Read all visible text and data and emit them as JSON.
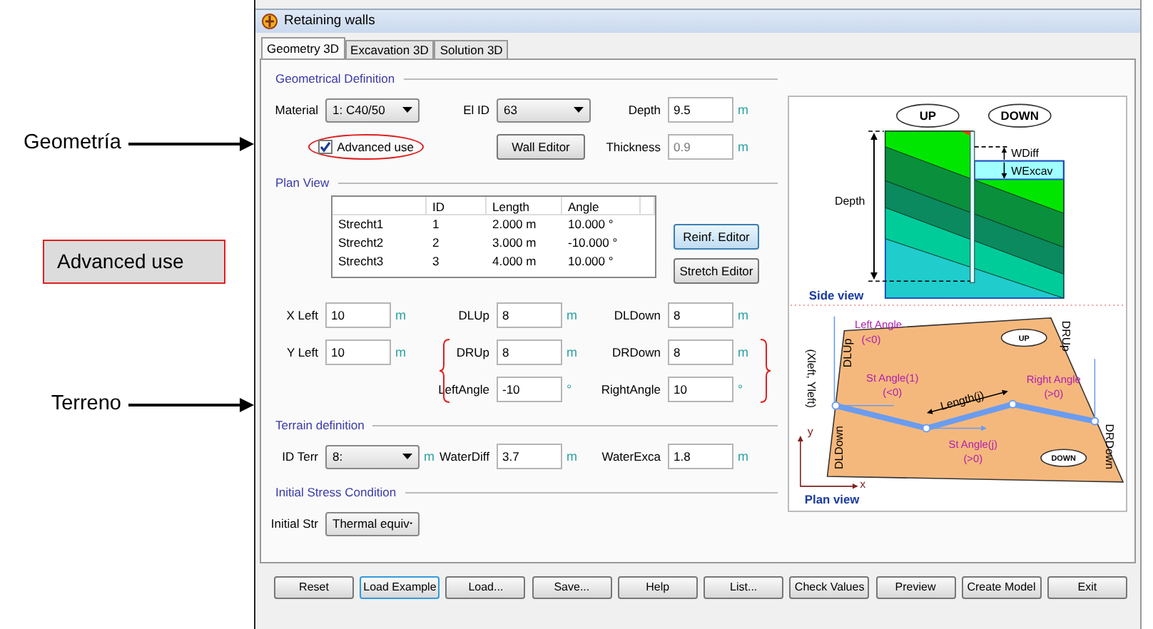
{
  "annotations": [
    {
      "kind": "arrow",
      "text": "Geometría"
    },
    {
      "kind": "box",
      "text": "Advanced use"
    },
    {
      "kind": "arrow",
      "text": "Terreno"
    }
  ],
  "window": {
    "title": "Retaining walls"
  },
  "tabs": [
    {
      "label": "Geometry 3D",
      "selected": true
    },
    {
      "label": "Excavation 3D",
      "selected": false
    },
    {
      "label": "Solution 3D",
      "selected": false
    }
  ],
  "sections": [
    {
      "kind": "form",
      "title": "Geometrical Definition",
      "rows": [
        [
          {
            "kind": "select",
            "label": "Material",
            "value": "1: C40/50"
          },
          {
            "kind": "select",
            "label": "El ID",
            "value": "63"
          },
          {
            "kind": "input",
            "label": "Depth",
            "value": "9.5",
            "unit": "m",
            "disabled": false
          }
        ],
        [
          {
            "kind": "checkbox",
            "label": "Advanced use",
            "checked": true,
            "highlighted": true
          },
          {
            "kind": "button",
            "label": "Wall Editor"
          },
          {
            "kind": "input",
            "label": "Thickness",
            "value": "0.9",
            "unit": "m",
            "disabled": true
          }
        ]
      ]
    },
    {
      "kind": "plan",
      "title": "Plan View",
      "table": {
        "columns": [
          "ID",
          "Length",
          "Angle"
        ],
        "rows": [
          {
            "name": "Strecht1",
            "cells": [
              "1",
              "2.000 m",
              "10.000 °"
            ]
          },
          {
            "name": "Strecht2",
            "cells": [
              "2",
              "3.000 m",
              "-10.000 °"
            ]
          },
          {
            "name": "Strecht3",
            "cells": [
              "3",
              "4.000 m",
              "10.000 °"
            ]
          }
        ]
      },
      "buttons": [
        {
          "label": "Reinf. Editor",
          "highlighted": true
        },
        {
          "label": "Stretch Editor",
          "highlighted": false
        }
      ],
      "rows": [
        [
          {
            "kind": "input",
            "label": "X Left",
            "value": "10",
            "unit": "m",
            "disabled": false
          },
          {
            "kind": "input",
            "label": "DLUp",
            "value": "8",
            "unit": "m",
            "disabled": false
          },
          {
            "kind": "input",
            "label": "DLDown",
            "value": "8",
            "unit": "m",
            "disabled": false
          }
        ],
        [
          {
            "kind": "input",
            "label": "Y Left",
            "value": "10",
            "unit": "m",
            "disabled": false
          },
          {
            "kind": "input",
            "label": "DRUp",
            "value": "8",
            "unit": "m",
            "disabled": false
          },
          {
            "kind": "input",
            "label": "DRDown",
            "value": "8",
            "unit": "m",
            "disabled": false
          }
        ],
        [
          {
            "kind": "none"
          },
          {
            "kind": "input",
            "label": "LeftAngle",
            "value": "-10",
            "unit": "°",
            "disabled": false
          },
          {
            "kind": "input",
            "label": "RightAngle",
            "value": "10",
            "unit": "°",
            "disabled": false
          }
        ]
      ]
    },
    {
      "kind": "form",
      "title": "Terrain definition",
      "rows": [
        [
          {
            "kind": "select",
            "label": "ID Terr",
            "value": "8:",
            "unit": "m"
          },
          {
            "kind": "input",
            "label": "WaterDiff",
            "value": "3.7",
            "unit": "m",
            "disabled": false
          },
          {
            "kind": "input",
            "label": "WaterExca",
            "value": "1.8",
            "unit": "m",
            "disabled": false
          }
        ]
      ]
    },
    {
      "kind": "form",
      "title": "Initial Stress Condition",
      "rows": [
        [
          {
            "kind": "select",
            "label": "Initial Str",
            "value": "Thermal equiv"
          }
        ]
      ]
    }
  ],
  "diagram": {
    "side_view": {
      "labels": [
        "UP",
        "DOWN",
        "WDiff",
        "WExcav",
        "Depth",
        "Side view"
      ]
    },
    "plan_view": {
      "labels": [
        "Left Angle",
        "(<0)",
        "DRUp",
        "UP",
        "DLUp",
        "(Xleft, Yleft)",
        "St Angle(1)",
        "(<0)",
        "Length(j)",
        "Right Angle",
        "(>0)",
        "DLDown",
        "St Angle(j)",
        "(>0)",
        "DRDown",
        "DOWN",
        "y",
        "x",
        "Plan view"
      ]
    }
  },
  "buttons": [
    {
      "label": "Reset",
      "focused": false
    },
    {
      "label": "Load Example",
      "focused": true
    },
    {
      "label": "Load...",
      "focused": false
    },
    {
      "label": "Save...",
      "focused": false
    },
    {
      "label": "Help",
      "focused": false
    },
    {
      "label": "List...",
      "focused": false
    },
    {
      "label": "Check Values",
      "focused": false
    },
    {
      "label": "Preview",
      "focused": false
    },
    {
      "label": "Create Model",
      "focused": false
    },
    {
      "label": "Exit",
      "focused": false
    }
  ]
}
